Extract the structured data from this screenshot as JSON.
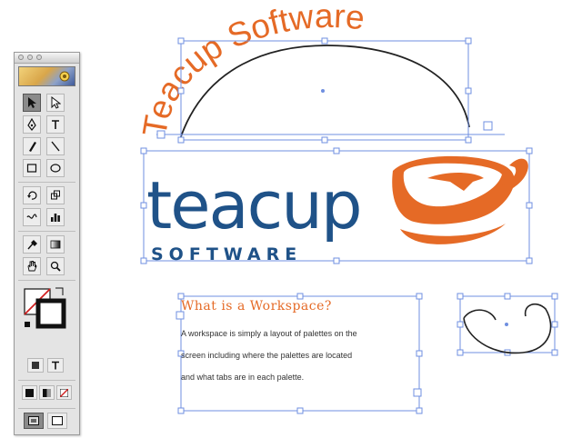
{
  "artwork": {
    "curved_title": "Teacup Software",
    "logo_wordmark": "teacup",
    "logo_subtitle": "SOFTWARE",
    "text_frame": {
      "heading": "What is a Workspace?",
      "lines": [
        "A workspace is simply a layout of palettes on the",
        "screen including where the palettes are located",
        "and what tabs are in each palette."
      ]
    }
  },
  "colors": {
    "brand_blue": "#1f5288",
    "brand_orange": "#e56a26",
    "selection_blue": "#6f8fe0"
  },
  "tools": [
    "selection-tool",
    "direct-selection-tool",
    "pen-tool",
    "type-tool",
    "pencil-tool",
    "line-tool",
    "rectangle-tool",
    "ellipse-tool",
    "rotate-tool",
    "scale-tool",
    "warp-tool",
    "graph-tool",
    "eyedropper-tool",
    "gradient-tool",
    "hand-tool",
    "zoom-tool"
  ]
}
